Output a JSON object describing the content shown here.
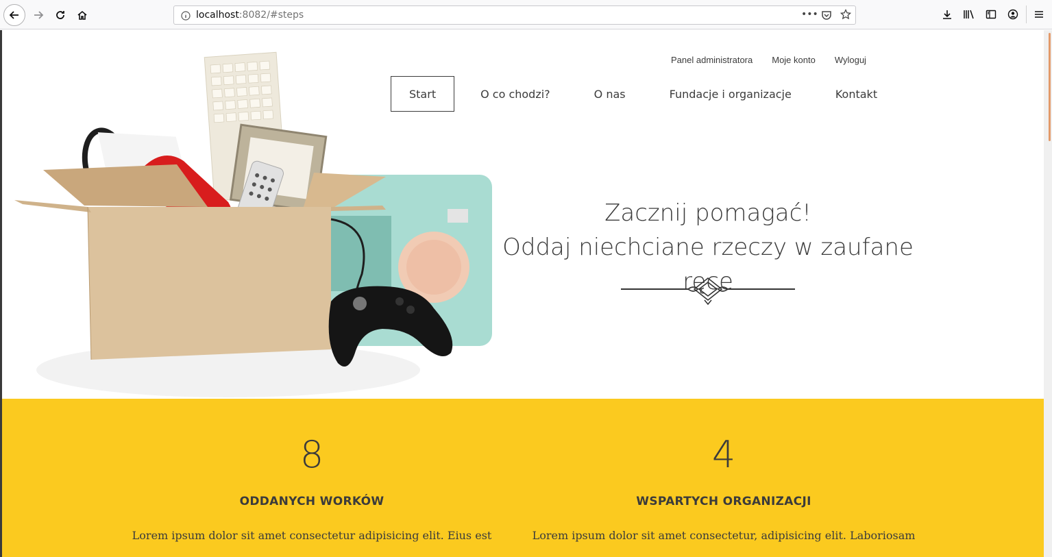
{
  "browser": {
    "url_host": "localhost",
    "url_rest": ":8082/#steps"
  },
  "top_links": [
    "Panel administratora",
    "Moje konto",
    "Wyloguj"
  ],
  "nav": [
    "Start",
    "O co chodzi?",
    "O nas",
    "Fundacje i organizacje",
    "Kontakt"
  ],
  "hero": {
    "line1": "Zacznij pomagać!",
    "line2": "Oddaj niechciane rzeczy w zaufane ręce"
  },
  "stats": [
    {
      "number": "8",
      "label": "ODDANYCH WORKÓW",
      "desc": "Lorem ipsum dolor sit amet consectetur adipisicing elit. Eius est"
    },
    {
      "number": "4",
      "label": "WSPARTYCH ORGANIZACJI",
      "desc": "Lorem ipsum dolor sit amet consectetur, adipisicing elit. Laboriosam"
    }
  ],
  "colors": {
    "accent_yellow": "#fbca1f",
    "text": "#3b3b3b"
  }
}
